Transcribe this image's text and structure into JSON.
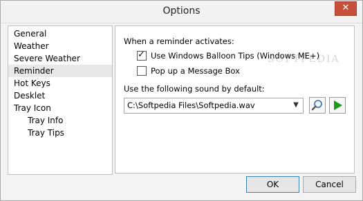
{
  "window": {
    "title": "Options",
    "close_glyph": "✕"
  },
  "nav": {
    "items": [
      {
        "label": "General",
        "indent": false,
        "selected": false
      },
      {
        "label": "Weather",
        "indent": false,
        "selected": false
      },
      {
        "label": "Severe Weather",
        "indent": false,
        "selected": false
      },
      {
        "label": "Reminder",
        "indent": false,
        "selected": true
      },
      {
        "label": "Hot Keys",
        "indent": false,
        "selected": false
      },
      {
        "label": "Desklet",
        "indent": false,
        "selected": false
      },
      {
        "label": "Tray Icon",
        "indent": false,
        "selected": false
      },
      {
        "label": "Tray Info",
        "indent": true,
        "selected": false
      },
      {
        "label": "Tray Tips",
        "indent": true,
        "selected": false
      }
    ]
  },
  "panel": {
    "watermark": "SOFTPEDIA",
    "reminder_heading": "When a reminder activates:",
    "balloon_label": "Use Windows Balloon Tips (Windows ME+)",
    "balloon_checked": true,
    "messagebox_label": "Pop up a Message Box",
    "messagebox_checked": false,
    "sound_heading": "Use the following sound by default:",
    "sound_path": "C:\\Softpedia Files\\Softpedia.wav",
    "browse_icon": "magnifier-icon",
    "play_icon": "play-icon",
    "play_color": "#1a9a1a"
  },
  "footer": {
    "ok_label": "OK",
    "cancel_label": "Cancel"
  }
}
